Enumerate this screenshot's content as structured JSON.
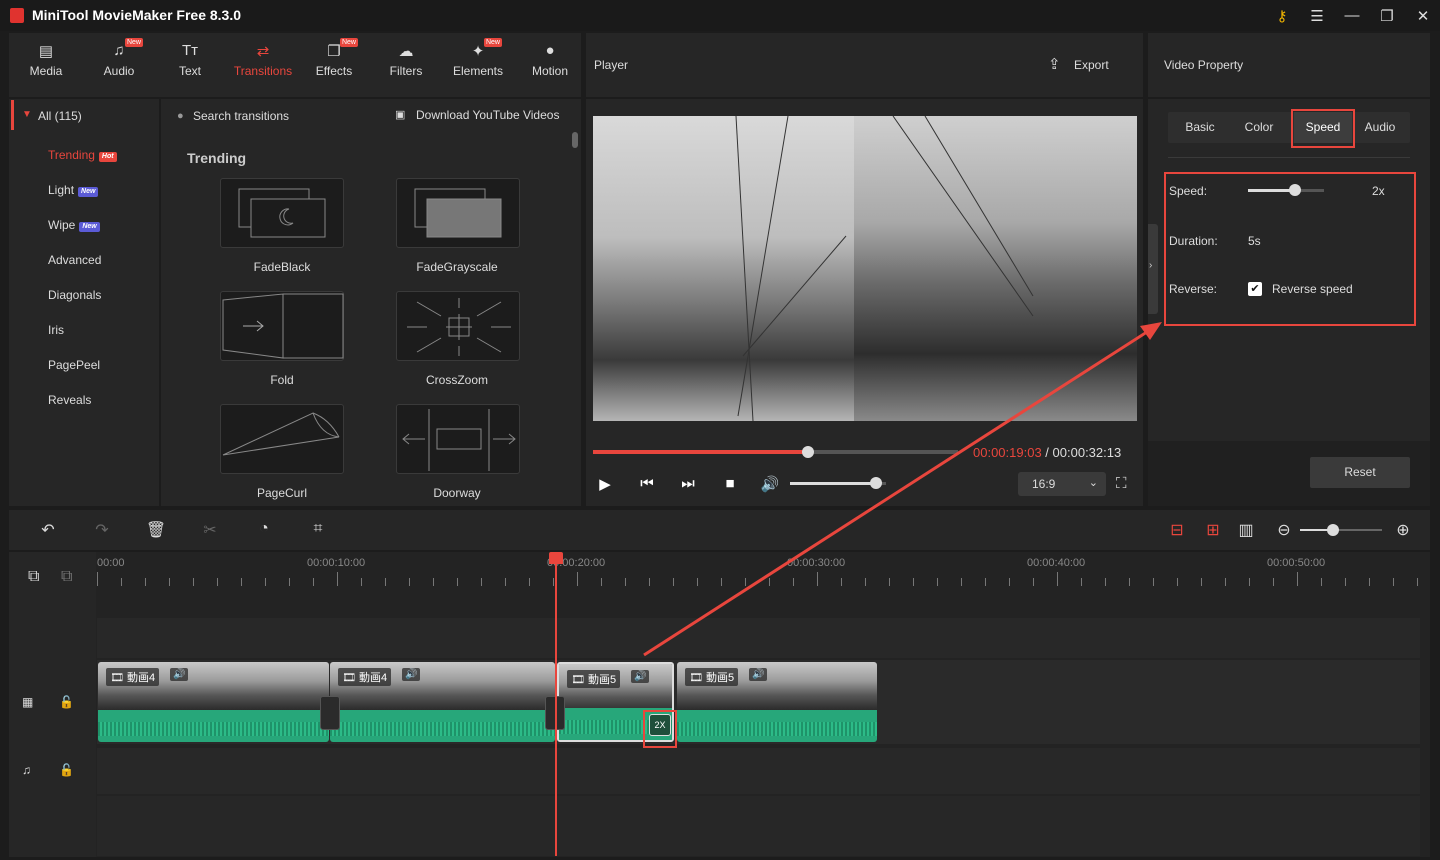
{
  "app": {
    "title": "MiniTool MovieMaker Free 8.3.0"
  },
  "toolbar": {
    "items": [
      {
        "label": "Media",
        "new": ""
      },
      {
        "label": "Audio",
        "new": "New"
      },
      {
        "label": "Text",
        "new": ""
      },
      {
        "label": "Transitions",
        "new": ""
      },
      {
        "label": "Effects",
        "new": "New"
      },
      {
        "label": "Filters",
        "new": ""
      },
      {
        "label": "Elements",
        "new": "New"
      },
      {
        "label": "Motion",
        "new": ""
      }
    ]
  },
  "sidebar": {
    "all_label": "All (115)",
    "items": [
      {
        "label": "Trending",
        "badge": "Hot"
      },
      {
        "label": "Light",
        "badge": "New"
      },
      {
        "label": "Wipe",
        "badge": "New"
      },
      {
        "label": "Advanced"
      },
      {
        "label": "Diagonals"
      },
      {
        "label": "Iris"
      },
      {
        "label": "PagePeel"
      },
      {
        "label": "Reveals"
      }
    ]
  },
  "library": {
    "search_placeholder": "Search transitions",
    "download_label": "Download YouTube Videos",
    "section_title": "Trending",
    "tiles": [
      "FadeBlack",
      "FadeGrayscale",
      "Fold",
      "CrossZoom",
      "PageCurl",
      "Doorway"
    ]
  },
  "player": {
    "title": "Player",
    "export_label": "Export",
    "time_current": "00:00:19:03",
    "time_sep": " / ",
    "time_total": "00:00:32:13",
    "progress": 0.59,
    "volume": 0.9,
    "aspect": "16:9"
  },
  "property": {
    "title": "Video Property",
    "tabs": [
      "Basic",
      "Color",
      "Speed",
      "Audio"
    ],
    "active_tab": "Speed",
    "speed_label": "Speed:",
    "speed_value": "2x",
    "speed_level": 0.62,
    "duration_label": "Duration:",
    "duration_value": "5s",
    "reverse_label": "Reverse:",
    "reverse_option": "Reverse speed",
    "reverse_checked": true,
    "reset_label": "Reset"
  },
  "timeline": {
    "ruler": [
      "00:00",
      "00:00:10:00",
      "00:00:20:00",
      "00:00:30:00",
      "00:00:40:00",
      "00:00:50:00"
    ],
    "clips": [
      {
        "name": "動画4"
      },
      {
        "name": "動画4"
      },
      {
        "name": "動画5",
        "speed_badge": "2X"
      },
      {
        "name": "動画5"
      }
    ],
    "zoom_level": 0.4
  },
  "colors": {
    "accent": "#e8463d",
    "waveform": "#27a77a",
    "panel": "#262626"
  }
}
